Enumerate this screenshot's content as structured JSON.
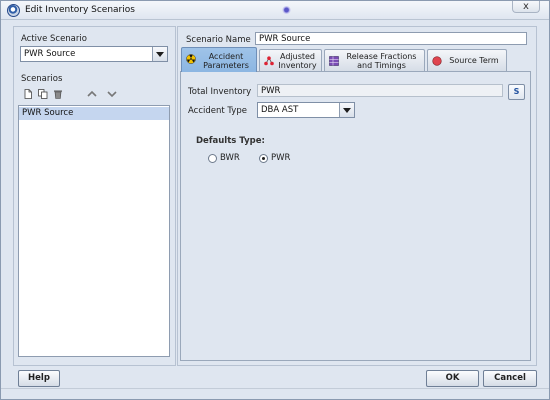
{
  "window": {
    "title": "Edit Inventory Scenarios",
    "close_label": "x"
  },
  "left": {
    "active_scenario_label": "Active Scenario",
    "active_scenario_value": "PWR Source",
    "scenarios_label": "Scenarios",
    "toolbar_icons": [
      "new-icon",
      "copy-icon",
      "delete-icon",
      "move-up-icon",
      "move-down-icon"
    ],
    "scenarios": [
      "PWR Source"
    ]
  },
  "right": {
    "scenario_name_label": "Scenario Name",
    "scenario_name_value": "PWR Source",
    "tabs": [
      {
        "label": "Accident Parameters",
        "active": true,
        "icon": "radiation-icon"
      },
      {
        "label": "Adjusted Inventory",
        "active": false,
        "icon": "molecule-icon"
      },
      {
        "label": "Release Fractions and Timings",
        "active": false,
        "icon": "table-icon"
      },
      {
        "label": "Source Term",
        "active": false,
        "icon": "red-circle-icon"
      }
    ],
    "total_inventory_label": "Total Inventory",
    "total_inventory_value": "PWR",
    "accident_type_label": "Accident Type",
    "accident_type_value": "DBA AST",
    "defaults_label": "Defaults Type:",
    "defaults_options": [
      {
        "label": "BWR",
        "checked": false
      },
      {
        "label": "PWR",
        "checked": true
      }
    ]
  },
  "buttons": {
    "help": "Help",
    "ok": "OK",
    "cancel": "Cancel"
  },
  "colors": {
    "window_bg": "#dfe6f0",
    "active_tab": "#8cb6e2",
    "selection": "#c5d6ef"
  }
}
